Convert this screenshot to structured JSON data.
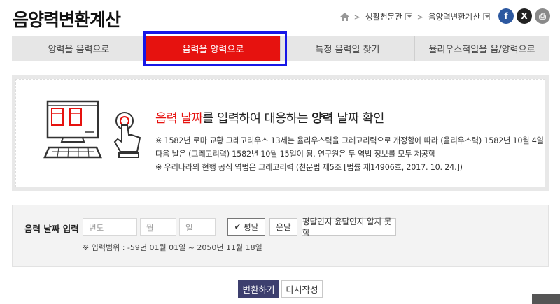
{
  "page": {
    "title": "음양력변환계산"
  },
  "breadcrumb": {
    "item1": "생활천문관",
    "item2": "음양력변환계산"
  },
  "social": {
    "facebook": "f",
    "x": "X",
    "print": "⎙"
  },
  "tabs": [
    {
      "label": "양력을 음력으로",
      "active": false
    },
    {
      "label": "음력을 양력으로",
      "active": true
    },
    {
      "label": "특정 음력일 찾기",
      "active": false
    },
    {
      "label": "율리우스적일을 음/양력으로",
      "active": false
    }
  ],
  "info": {
    "heading_red": "음력 날짜",
    "heading_mid": "를 입력하여 대응하는 ",
    "heading_bold": "양력",
    "heading_end": " 날짜 확인",
    "note1": "※ 1582년 로마 교황 그레고리우스 13세는 율리우스력을 그레고리력으로 개정함에 따라 (율리우스력) 1582년 10월 4일",
    "note2": "다음 날은 (그레고리력) 1582년 10월 15일이 됨. 연구원은 두 역법 정보를 모두 제공함",
    "note3": "※ 우리나라의 현행 공식 역법은 그레고리력 (천문법 제5조 [법률 제14906호, 2017. 10. 24.])"
  },
  "form": {
    "label": "음력 날짜 입력",
    "year_placeholder": "년도",
    "month_placeholder": "월",
    "day_placeholder": "일",
    "normal_month": "평달",
    "leap_month": "윤달",
    "unknown_month": "평달인지 윤달인지 알지 못함",
    "range": "※ 입력범위 : -59년 01월 01일 ~ 2050년 11월 18일"
  },
  "actions": {
    "convert": "변환하기",
    "reset": "다시작성"
  },
  "colors": {
    "accent": "#e6120f",
    "primary_button": "#3d3f6e",
    "highlight": "#1717e6"
  }
}
